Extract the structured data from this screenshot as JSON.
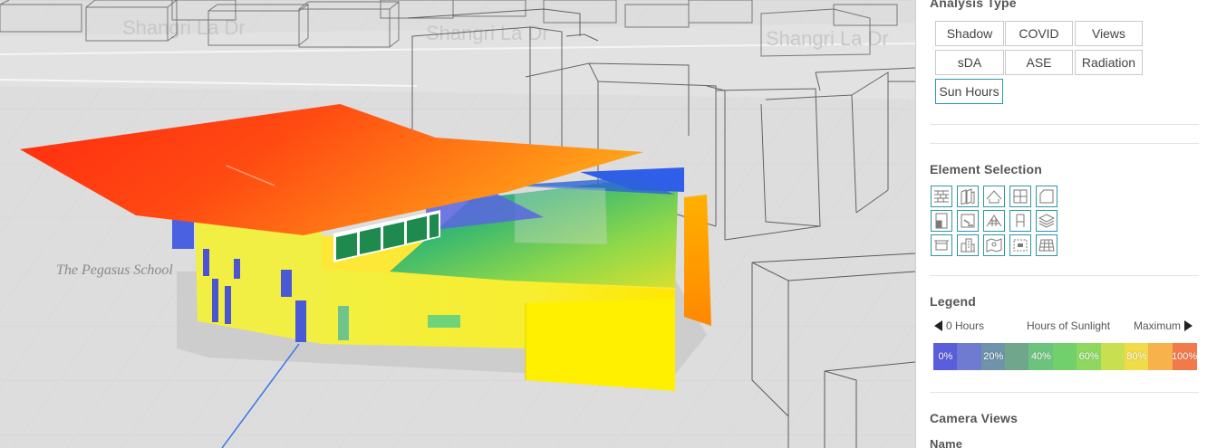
{
  "viewport": {
    "street_labels": [
      "Shangri La Dr",
      "Shangri La Dr",
      "Shangri La Dr"
    ],
    "building_label": "The Pegasus School"
  },
  "panel": {
    "analysis_type": {
      "title": "Analysis Type",
      "buttons": [
        "Shadow",
        "COVID",
        "Views",
        "sDA",
        "ASE",
        "Radiation",
        "Sun Hours"
      ],
      "active": "Sun Hours"
    },
    "element_selection": {
      "title": "Element Selection",
      "icons": [
        "brick-wall-icon",
        "wall-panels-icon",
        "roof-icon",
        "window-icon",
        "floor-plan-icon",
        "door-icon",
        "floor-icon",
        "dome-roof-icon",
        "chair-icon",
        "layers-icon",
        "ceiling-icon",
        "buildings-icon",
        "site-map-icon",
        "slab-icon",
        "grid-icon"
      ]
    },
    "legend": {
      "title": "Legend",
      "min_label": "0 Hours",
      "center_label": "Hours of Sunlight",
      "max_label": "Maximum",
      "scale": [
        {
          "label": "0%",
          "color": "#5a5ddc"
        },
        {
          "label": "",
          "color": "#6f7bd0"
        },
        {
          "label": "20%",
          "color": "#6f93a8"
        },
        {
          "label": "",
          "color": "#70a68c"
        },
        {
          "label": "40%",
          "color": "#6cc47c"
        },
        {
          "label": "",
          "color": "#72d06c"
        },
        {
          "label": "60%",
          "color": "#8ed860"
        },
        {
          "label": "",
          "color": "#c8e050"
        },
        {
          "label": "80%",
          "color": "#f0dc48"
        },
        {
          "label": "",
          "color": "#f8b24c"
        },
        {
          "label": "100%",
          "color": "#f27a4a"
        }
      ]
    },
    "camera_views": {
      "title": "Camera Views",
      "name_label": "Name"
    }
  }
}
